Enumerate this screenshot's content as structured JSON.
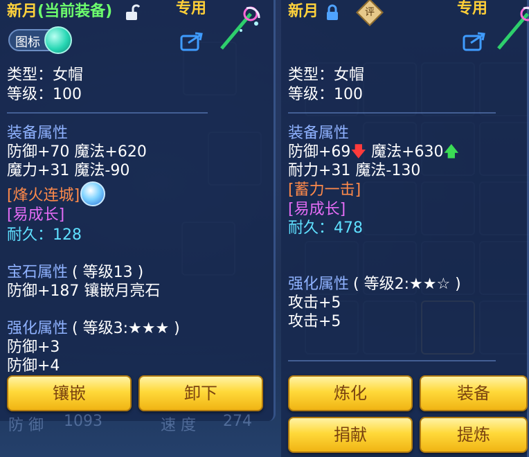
{
  "left_panel": {
    "title_name": "新月",
    "title_status": "(当前装备)",
    "exclusive": "专用",
    "icon_toggle_label": "图标",
    "type_line": "类型：女帽",
    "level_line": "等级：100",
    "equip_attr_header": "装备属性",
    "attr_line1": "防御+70 魔法+620",
    "attr_line2": "魔力+31 魔法-90",
    "special_skill": "[烽火连城]",
    "trait": "[易成长]",
    "durability": "耐久：128",
    "gem_header": "宝石属性",
    "gem_level": "( 等级13 )",
    "gem_line": "防御+187 镶嵌月亮石",
    "enhance_header": "强化属性",
    "enhance_level": "( 等级3:★★★ )",
    "enhance_line1": "防御+3",
    "enhance_line2": "防御+4",
    "btn_inlay": "镶嵌",
    "btn_unequip": "卸下",
    "bg_stat_left": "防 御",
    "bg_stat_left_val": "1093",
    "bg_stat_right": "速 度",
    "bg_stat_right_val": "274"
  },
  "right_panel": {
    "title_name": "新月",
    "eval_badge": "评",
    "exclusive": "专用",
    "type_line": "类型：女帽",
    "level_line": "等级：100",
    "equip_attr_header": "装备属性",
    "attr_line1_a": "防御+69",
    "attr_line1_b": "魔法+630",
    "attr_line2": "耐力+31 魔法-130",
    "special_skill": "[蓄力一击]",
    "trait": "[易成长]",
    "durability": "耐久：478",
    "enhance_header": "强化属性",
    "enhance_level": "( 等级2:★★☆ )",
    "enhance_line1": "攻击+5",
    "enhance_line2": "攻击+5",
    "btn_refine": "炼化",
    "btn_equip": "装备",
    "btn_donate": "捐献",
    "btn_extract": "提炼"
  },
  "colors": {
    "title_gold": "#ffd23c",
    "status_green": "#6dff6d",
    "attr_blue": "#8fb2ff",
    "durability_cyan": "#5fe0ff",
    "skill_orange": "#ff8a4a",
    "trait_purple": "#e36cf5",
    "button_gold": "#ffd93a"
  },
  "icons": [
    "unlock-icon",
    "lock-icon",
    "share-icon",
    "wand-icon",
    "skill-orb-icon",
    "down-arrow-icon",
    "up-arrow-icon",
    "eval-badge-icon"
  ]
}
